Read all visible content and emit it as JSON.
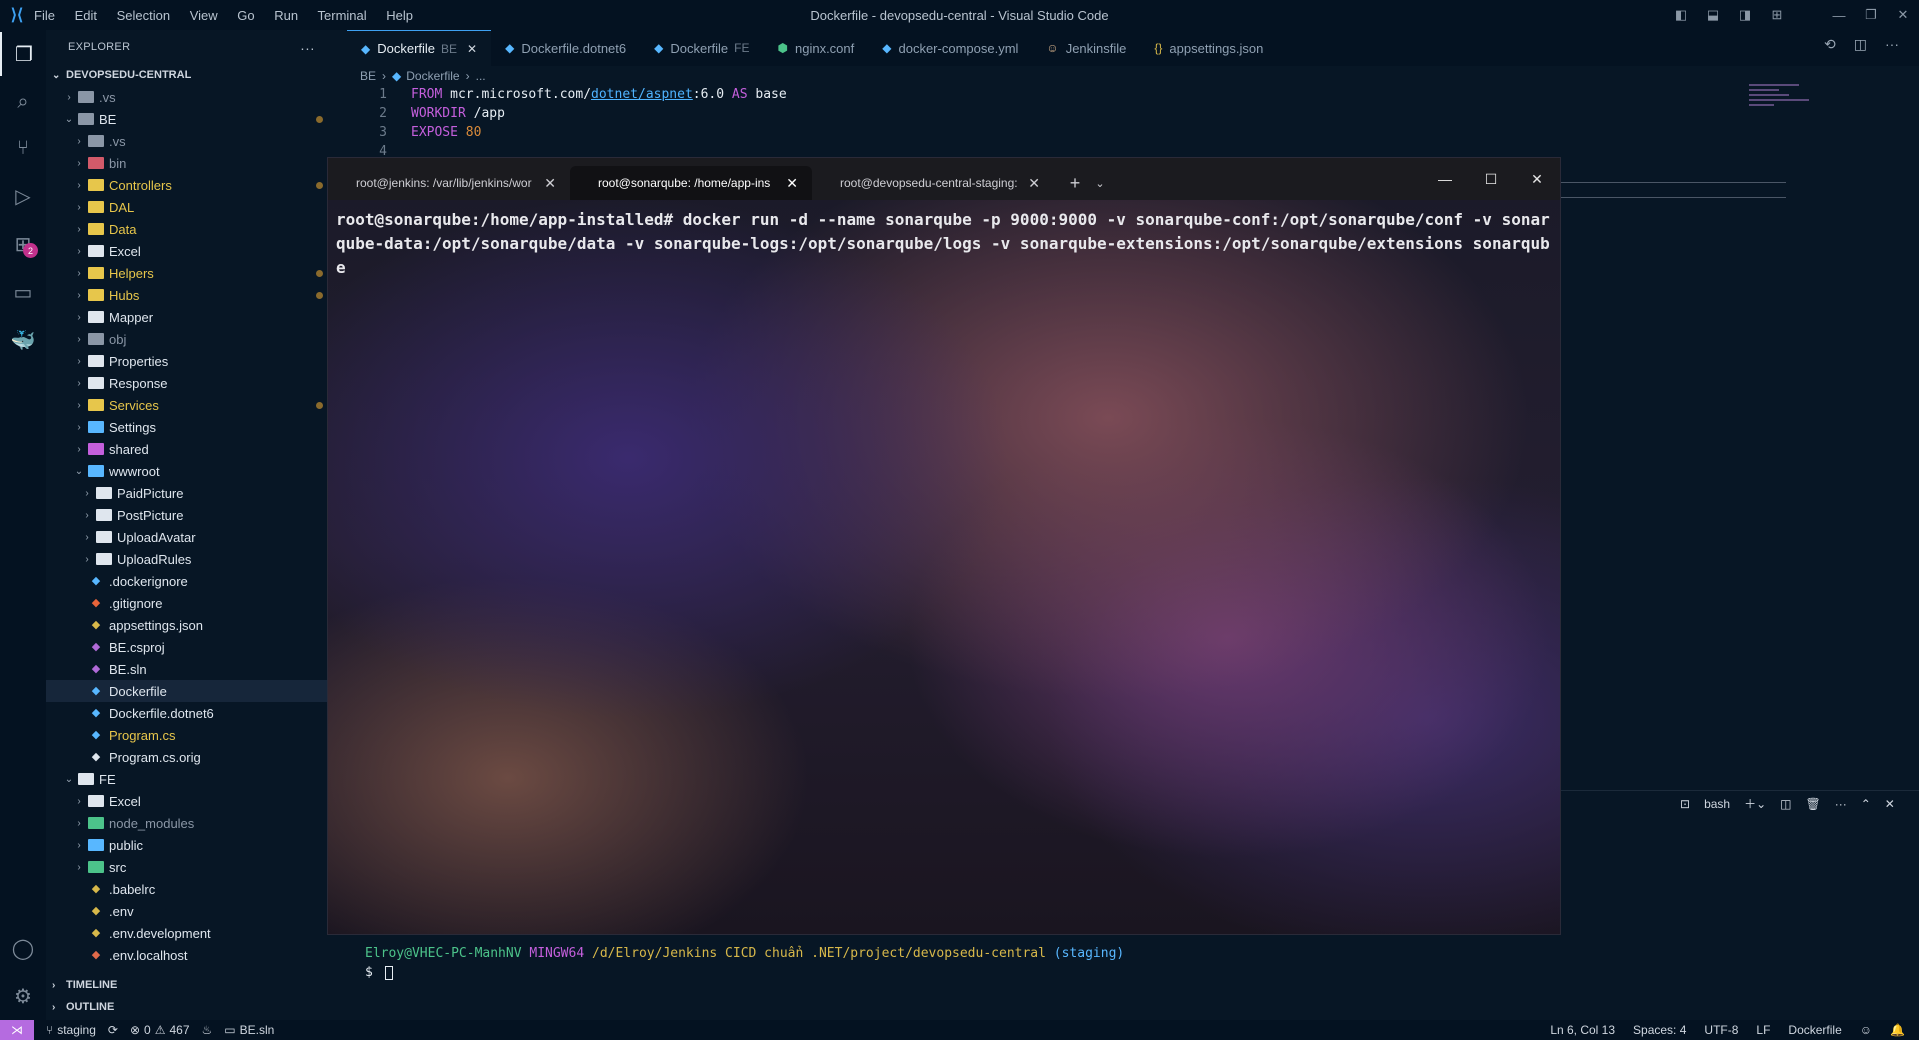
{
  "titlebar": {
    "menu": [
      "File",
      "Edit",
      "Selection",
      "View",
      "Go",
      "Run",
      "Terminal",
      "Help"
    ],
    "window_title": "Dockerfile - devopsedu-central - Visual Studio Code"
  },
  "activity": {
    "extensions_badge": "2"
  },
  "explorer": {
    "title": "EXPLORER",
    "root": "DEVOPSEDU-CENTRAL",
    "items": [
      {
        "label": ".vs",
        "chev": "›",
        "color": "#8a96a6"
      },
      {
        "label": "BE",
        "chev": "⌄",
        "color": "#dfe6ee"
      },
      {
        "label": ".vs",
        "chev": "›",
        "color": "#8a96a6"
      },
      {
        "label": "bin",
        "chev": "›",
        "color": "#8a96a6"
      },
      {
        "label": "Controllers",
        "chev": "›",
        "color": "#e7c64b"
      },
      {
        "label": "DAL",
        "chev": "›",
        "color": "#e7c64b"
      },
      {
        "label": "Data",
        "chev": "›",
        "color": "#e7c64b"
      },
      {
        "label": "Excel",
        "chev": "›",
        "color": "#dfe6ee"
      },
      {
        "label": "Helpers",
        "chev": "›",
        "color": "#e7c64b"
      },
      {
        "label": "Hubs",
        "chev": "›",
        "color": "#e7c64b"
      },
      {
        "label": "Mapper",
        "chev": "›",
        "color": "#dfe6ee"
      },
      {
        "label": "obj",
        "chev": "›",
        "color": "#8a96a6"
      },
      {
        "label": "Properties",
        "chev": "›",
        "color": "#dfe6ee"
      },
      {
        "label": "Response",
        "chev": "›",
        "color": "#dfe6ee"
      },
      {
        "label": "Services",
        "chev": "›",
        "color": "#e7c64b"
      },
      {
        "label": "Settings",
        "chev": "›",
        "color": "#dfe6ee"
      },
      {
        "label": "shared",
        "chev": "›",
        "color": "#dfe6ee"
      },
      {
        "label": "wwwroot",
        "chev": "⌄",
        "color": "#dfe6ee"
      },
      {
        "label": "PaidPicture",
        "chev": "›",
        "color": "#dfe6ee"
      },
      {
        "label": "PostPicture",
        "chev": "›",
        "color": "#dfe6ee"
      },
      {
        "label": "UploadAvatar",
        "chev": "›",
        "color": "#dfe6ee"
      },
      {
        "label": "UploadRules",
        "chev": "›",
        "color": "#dfe6ee"
      },
      {
        "label": ".dockerignore",
        "chev": "",
        "color": "#dfe6ee"
      },
      {
        "label": ".gitignore",
        "chev": "",
        "color": "#dfe6ee"
      },
      {
        "label": "appsettings.json",
        "chev": "",
        "color": "#dfe6ee"
      },
      {
        "label": "BE.csproj",
        "chev": "",
        "color": "#dfe6ee"
      },
      {
        "label": "BE.sln",
        "chev": "",
        "color": "#dfe6ee"
      },
      {
        "label": "Dockerfile",
        "chev": "",
        "color": "#dfe6ee"
      },
      {
        "label": "Dockerfile.dotnet6",
        "chev": "",
        "color": "#dfe6ee"
      },
      {
        "label": "Program.cs",
        "chev": "",
        "color": "#e7c64b"
      },
      {
        "label": "Program.cs.orig",
        "chev": "",
        "color": "#dfe6ee"
      },
      {
        "label": "FE",
        "chev": "⌄",
        "color": "#dfe6ee"
      },
      {
        "label": "Excel",
        "chev": "›",
        "color": "#dfe6ee"
      },
      {
        "label": "node_modules",
        "chev": "›",
        "color": "#8a96a6"
      },
      {
        "label": "public",
        "chev": "›",
        "color": "#dfe6ee"
      },
      {
        "label": "src",
        "chev": "›",
        "color": "#dfe6ee"
      },
      {
        "label": ".babelrc",
        "chev": "",
        "color": "#dfe6ee"
      },
      {
        "label": ".env",
        "chev": "",
        "color": "#dfe6ee"
      },
      {
        "label": ".env.development",
        "chev": "",
        "color": "#dfe6ee"
      },
      {
        "label": ".env.localhost",
        "chev": "",
        "color": "#dfe6ee"
      }
    ],
    "timeline": "TIMELINE",
    "outline": "OUTLINE"
  },
  "editor": {
    "tabs": [
      {
        "label": "Dockerfile",
        "desc": "BE",
        "icon": "docker-icon"
      },
      {
        "label": "Dockerfile.dotnet6",
        "desc": "",
        "icon": "docker-icon"
      },
      {
        "label": "Dockerfile",
        "desc": "FE",
        "icon": "docker-icon"
      },
      {
        "label": "nginx.conf",
        "desc": "",
        "icon": "nginx-icon"
      },
      {
        "label": "docker-compose.yml",
        "desc": "",
        "icon": "docker-icon"
      },
      {
        "label": "Jenkinsfile",
        "desc": "",
        "icon": "jenkins-icon"
      },
      {
        "label": "appsettings.json",
        "desc": "",
        "icon": "json-icon"
      }
    ],
    "breadcrumb": [
      "BE",
      "Dockerfile",
      "..."
    ],
    "lines": [
      {
        "n": "1",
        "kw": "FROM",
        "rest1": " mcr.microsoft.com/",
        "ul": "dotnet/aspnet",
        "rest2": ":6.0 ",
        "kw2": "AS",
        "rest3": " base"
      },
      {
        "n": "2",
        "kw": "WORKDIR",
        "rest1": " /app",
        "ul": "",
        "rest2": "",
        "kw2": "",
        "rest3": ""
      },
      {
        "n": "3",
        "kw": "EXPOSE",
        "rest1": " ",
        "num": "80",
        "ul": "",
        "rest2": "",
        "kw2": "",
        "rest3": ""
      },
      {
        "n": "4",
        "kw": "",
        "rest1": "",
        "ul": "",
        "rest2": "",
        "kw2": "",
        "rest3": ""
      }
    ]
  },
  "panel": {
    "shell": "bash",
    "prompt_user": "Elroy@VHEC-PC-ManhNV",
    "prompt_env": "MINGW64",
    "prompt_path": "/d/Elroy/Jenkins CICD chuẩn .NET/project/devopsedu-central",
    "prompt_branch": "(staging)",
    "prompt_symbol": "$"
  },
  "terminal_window": {
    "tabs": [
      {
        "label": "root@jenkins: /var/lib/jenkins/wor"
      },
      {
        "label": "root@sonarqube: /home/app-ins"
      },
      {
        "label": "root@devopsedu-central-staging:"
      }
    ],
    "command": "root@sonarqube:/home/app-installed# docker run -d --name sonarqube -p 9000:9000 -v sonarqube-conf:/opt/sonarqube/conf -v sonarqube-data:/opt/sonarqube/data -v sonarqube-logs:/opt/sonarqube/logs -v sonarqube-extensions:/opt/sonarqube/extensions sonarqube"
  },
  "statusbar": {
    "branch": "staging",
    "errors": "0",
    "warnings": "467",
    "solution": "BE.sln",
    "position": "Ln 6, Col 13",
    "spaces": "Spaces: 4",
    "encoding": "UTF-8",
    "eol": "LF",
    "language": "Dockerfile"
  }
}
